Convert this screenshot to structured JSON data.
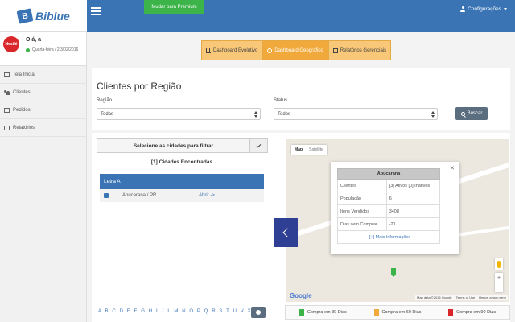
{
  "app": {
    "logo_text": "Biblue",
    "premium_label": "Mudar para Premium",
    "config_label": "Configurações"
  },
  "user": {
    "avatar_text": "Nestlé",
    "greeting": "Olá, a",
    "date": "Quarta-feira / 2 3/02/2016"
  },
  "sidebar": {
    "items": [
      {
        "label": "Tela Inicial",
        "icon": "home-icon"
      },
      {
        "label": "Clientes",
        "icon": "users-icon"
      },
      {
        "label": "Pedidos",
        "icon": "orders-icon"
      },
      {
        "label": "Relatórios",
        "icon": "reports-icon"
      }
    ]
  },
  "tabs": [
    {
      "label": "Dashboard Evolutivo",
      "icon": "bar-chart-icon",
      "active": false
    },
    {
      "label": "Dashboard Geográfico",
      "icon": "globe-icon",
      "active": true
    },
    {
      "label": "Relatórios Gerenciais",
      "icon": "report-icon",
      "active": false
    }
  ],
  "filters": {
    "title": "Clientes por Região",
    "region_label": "Região",
    "region_value": "Todas",
    "status_label": "Status",
    "status_value": "Todos",
    "search_label": "Buscar"
  },
  "cities": {
    "header": "Selecione as cidades para filtrar",
    "found": "[1] Cidades Encontradas",
    "letter_group": "Letra A",
    "rows": [
      {
        "name": "Apucarana / PR",
        "action": "Abrir ->"
      }
    ],
    "alphabet": "A B C D E F G H I J L M N O P Q R S T U V X Z W"
  },
  "map": {
    "toggle_map": "Map",
    "toggle_satellite": "Satellite",
    "info": {
      "title": "Apucarana",
      "rows": [
        {
          "label": "Clientes",
          "value": "[3] Ativos [0] Inativos"
        },
        {
          "label": "População",
          "value": "6"
        },
        {
          "label": "Itens Vendidos",
          "value": "3408"
        },
        {
          "label": "Dias sem Comprar",
          "value": "-21"
        }
      ],
      "more_link": "[+] Mais Informações"
    },
    "google": "Google",
    "credit_data": "Map data ©2016 Google",
    "credit_terms": "Terms of Use",
    "credit_report": "Report a map error"
  },
  "legend": [
    {
      "label": "Compra em 30 Dias",
      "color": "#3cb44a"
    },
    {
      "label": "Compra em 60 Dias",
      "color": "#f0a93a"
    },
    {
      "label": "Compra em 90 Dias",
      "color": "#d8262b"
    }
  ]
}
